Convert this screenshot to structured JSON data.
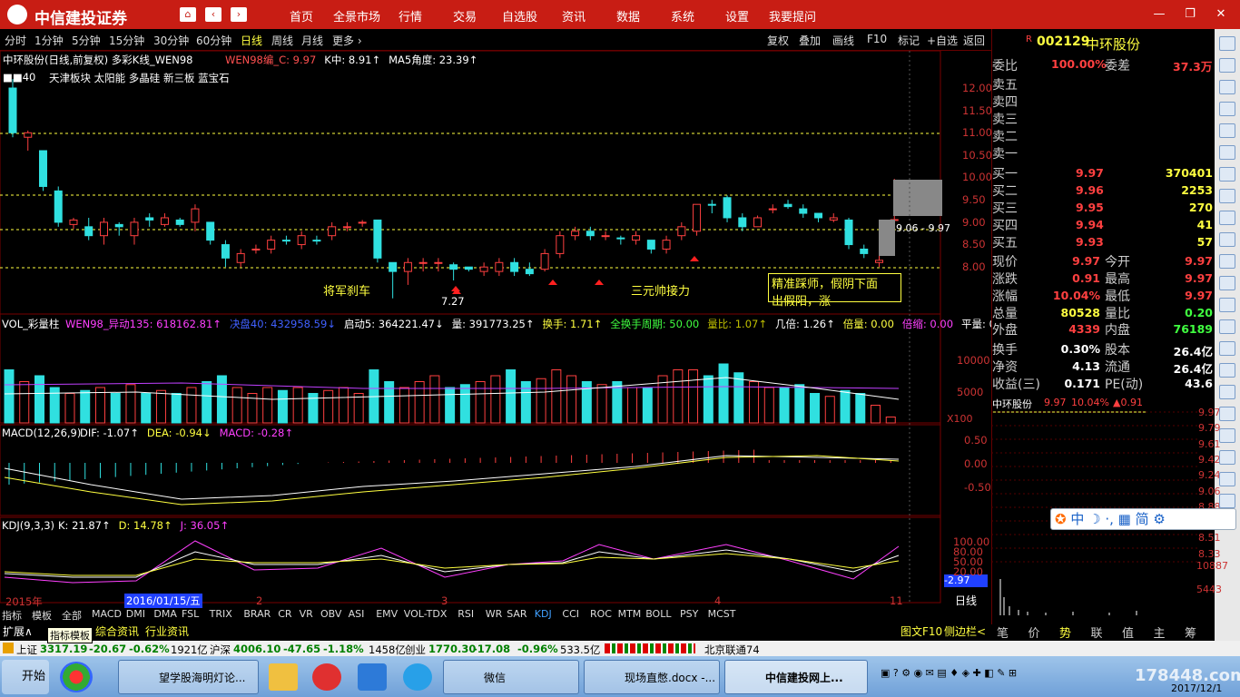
{
  "app": {
    "logo_text": "中信建投证券",
    "nav_home": "⌂",
    "nav_back": "‹",
    "nav_fwd": "›"
  },
  "menu": [
    "首页",
    "全景市场",
    "行情",
    "交易",
    "自选股",
    "资讯",
    "数据",
    "系统",
    "设置",
    "我要提问"
  ],
  "periods": [
    "分时",
    "1分钟",
    "5分钟",
    "15分钟",
    "30分钟",
    "60分钟",
    "日线",
    "周线",
    "月线",
    "更多 ›"
  ],
  "tools": [
    "复权",
    "叠加",
    "画线",
    "F10",
    "标记",
    "+自选",
    "返回"
  ],
  "stock": {
    "code": "002129",
    "name": "中环股份",
    "flag": "R"
  },
  "chart": {
    "main_title": "中环股份(日线,前复权) 多彩K线_WEN98",
    "main_title_parts": [
      {
        "text": "WEN98编_C: 9.97",
        "color": "#ff5050"
      },
      {
        "text": "K中: 8.91↑",
        "color": "#ffffff"
      },
      {
        "text": "MA5角度: 23.39↑",
        "color": "#ffffff"
      }
    ],
    "concept_prefix": "■■40",
    "concepts": "天津板块 太阳能 多晶硅 新三板 蓝宝石",
    "price_ticks": [
      "12.00",
      "11.50",
      "11.00",
      "10.50",
      "10.00",
      "9.50",
      "9.00",
      "8.50",
      "8.00"
    ],
    "annotations": {
      "a1": "将军刹车",
      "a2": "三元帅接力",
      "a3": "精准踩师，假阴下面",
      "a4": "出假阳，涨",
      "low": "7.27",
      "lvl": "9.06 - 9.97"
    },
    "vol_title": "VOL_彩量柱",
    "vol_parts": [
      {
        "text": "WEN98_异动135: 618162.81↑",
        "color": "#ff40ff"
      },
      {
        "text": "决盘40: 432958.59↓",
        "color": "#4060ff"
      },
      {
        "text": "启动5: 364221.47↓",
        "color": "#ffffff"
      },
      {
        "text": "量: 391773.25↑",
        "color": "#ffffff"
      },
      {
        "text": "换手: 1.71↑",
        "color": "#ffff40"
      },
      {
        "text": "全换手周期: 50.00",
        "color": "#40ff40"
      },
      {
        "text": "量比: 1.07↑",
        "color": "#c0c000"
      },
      {
        "text": "几倍: 1.26↑",
        "color": "#ffffff"
      },
      {
        "text": "倍量: 0.00",
        "color": "#ffff40"
      },
      {
        "text": "倍缩: 0.00",
        "color": "#ff40ff"
      },
      {
        "text": "平量: 0.",
        "color": "#ffffff"
      }
    ],
    "vol_ticks": [
      "10000",
      "5000"
    ],
    "vol_unit": "X100",
    "macd_title": "MACD(12,26,9)",
    "macd_parts": [
      {
        "text": "DIF: -1.07↑",
        "color": "#ffffff"
      },
      {
        "text": "DEA: -0.94↓",
        "color": "#ffff40"
      },
      {
        "text": "MACD: -0.28↑",
        "color": "#ff40ff"
      }
    ],
    "macd_ticks": [
      "0.50",
      "0.00",
      "-0.50"
    ],
    "kdj_title": "KDJ(9,3,3)",
    "kdj_parts": [
      {
        "text": "K: 21.87↑",
        "color": "#ffffff"
      },
      {
        "text": "D: 14.78↑",
        "color": "#ffff40"
      },
      {
        "text": "J: 36.05↑",
        "color": "#ff40ff"
      }
    ],
    "kdj_ticks": [
      "100.00",
      "80.00",
      "50.00",
      "20.00"
    ],
    "kdj_cursor": "-2.97",
    "xaxis": {
      "year": "2015年",
      "date": "2016/01/15/五",
      "m2": "2",
      "m3": "3",
      "m4": "4",
      "m11": "11"
    },
    "period_label": "日线"
  },
  "indicator_tabs": [
    "指标",
    "模板",
    "全部",
    "MACD",
    "DMI",
    "DMA",
    "FSL",
    "TRIX",
    "BRAR",
    "CR",
    "VR",
    "OBV",
    "ASI",
    "EMV",
    "VOL-TDX",
    "RSI",
    "WR",
    "SAR",
    "KDJ",
    "CCI",
    "ROC",
    "MTM",
    "BOLL",
    "PSY",
    "MCST"
  ],
  "bottom_links": {
    "expand": "扩展∧",
    "tooltip": "指标模板",
    "news": "综合资讯",
    "industry": "行业资讯",
    "f10": "图文F10",
    "side": "侧边栏<"
  },
  "quote": {
    "wb_label": "委比",
    "wb": "100.00%",
    "wc_label": "委差",
    "wc": "37.3万",
    "asks": [
      {
        "l": "卖五"
      },
      {
        "l": "卖四"
      },
      {
        "l": "卖三"
      },
      {
        "l": "卖二"
      },
      {
        "l": "卖一"
      }
    ],
    "bids": [
      {
        "l": "买一",
        "p": "9.97",
        "v": "370401"
      },
      {
        "l": "买二",
        "p": "9.96",
        "v": "2253"
      },
      {
        "l": "买三",
        "p": "9.95",
        "v": "270"
      },
      {
        "l": "买四",
        "p": "9.94",
        "v": "41"
      },
      {
        "l": "买五",
        "p": "9.93",
        "v": "57"
      }
    ],
    "stats": [
      {
        "l": "现价",
        "v": "9.97",
        "c": "#ff4040",
        "l2": "今开",
        "v2": "9.97",
        "c2": "#ff4040"
      },
      {
        "l": "涨跌",
        "v": "0.91",
        "c": "#ff4040",
        "l2": "最高",
        "v2": "9.97",
        "c2": "#ff4040"
      },
      {
        "l": "涨幅",
        "v": "10.04%",
        "c": "#ff4040",
        "l2": "最低",
        "v2": "9.97",
        "c2": "#ff4040"
      },
      {
        "l": "总量",
        "v": "80528",
        "c": "#ffff40",
        "l2": "量比",
        "v2": "0.20",
        "c2": "#40ff40"
      },
      {
        "l": "外盘",
        "v": "4339",
        "c": "#ff4040",
        "l2": "内盘",
        "v2": "76189",
        "c2": "#40ff40"
      }
    ],
    "stats2": [
      {
        "l": "换手",
        "v": "0.30%",
        "l2": "股本",
        "v2": "26.4亿"
      },
      {
        "l": "净资",
        "v": "4.13",
        "l2": "流通",
        "v2": "26.4亿"
      },
      {
        "l": "收益(三)",
        "v": "0.171",
        "l2": "PE(动)",
        "v2": "43.6"
      }
    ],
    "mini_name": "中环股份",
    "mini_price": "9.97",
    "mini_pct": "10.04%",
    "mini_chg": "▲0.91",
    "mini_ticks": [
      "9.97",
      "9.79",
      "9.61",
      "9.42",
      "9.24",
      "9.06",
      "8.88",
      "8.70",
      "8.51",
      "8.33"
    ],
    "mini_vol": [
      "10887",
      "5443"
    ],
    "bottom_tabs": [
      "笔",
      "价",
      "势",
      "联",
      "值",
      "主",
      "筹"
    ],
    "ime": "中 ☽ ·, ▦ 简 ⚙"
  },
  "status": {
    "sh_label": "上证",
    "sh": "3317.19",
    "sh_chg": "-20.67",
    "sh_pct": "-0.62%",
    "sh_amt": "1921亿",
    "sz_label": "沪深",
    "sz": "4006.10",
    "sz_chg": "-47.65",
    "sz_pct": "-1.18%",
    "sz_amt": "1458亿",
    "cy_label": "创业",
    "cy": "1770.30",
    "cy_chg": "-17.08",
    "cy_pct": "-0.96%",
    "cy_amt": "533.5亿",
    "net": "北京联通74"
  },
  "taskbar": {
    "start": "开始",
    "tasks": [
      "望学股海明灯论...",
      "",
      "",
      "",
      "微信",
      "现场直憋.docx -...",
      "中信建投网上..."
    ],
    "date": "2017/12/1",
    "watermark": "178448.com"
  },
  "colors": {
    "up": "#ff4040",
    "down": "#30e0e0",
    "accent": "#c81d14"
  }
}
